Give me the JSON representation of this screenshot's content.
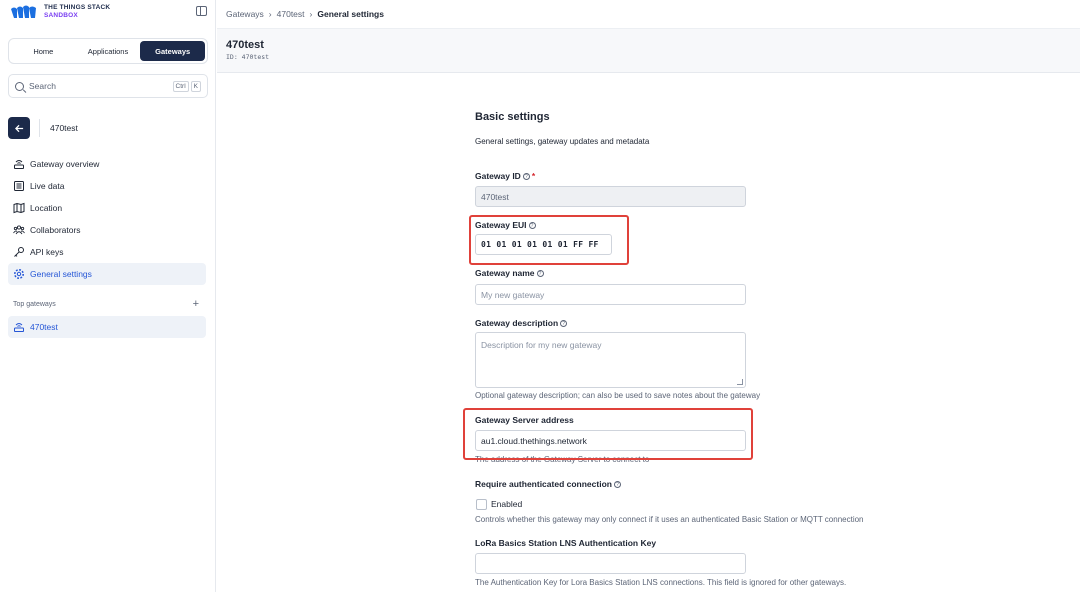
{
  "brand": {
    "line1": "THE THINGS STACK",
    "line2": "SANDBOX",
    "colors": {
      "navy": "#1c2a4a",
      "purple": "#7a3ff2",
      "accent": "#2556d6",
      "highlight": "#e0413a"
    }
  },
  "sidebar": {
    "tabs": [
      {
        "label": "Home"
      },
      {
        "label": "Applications"
      },
      {
        "label": "Gateways",
        "active": true
      }
    ],
    "search": {
      "placeholder": "Search",
      "shortcut": [
        "Ctrl",
        "K"
      ]
    },
    "context_title": "470test",
    "nav": [
      {
        "label": "Gateway overview",
        "icon": "gateway-icon"
      },
      {
        "label": "Live data",
        "icon": "list-icon"
      },
      {
        "label": "Location",
        "icon": "map-icon"
      },
      {
        "label": "Collaborators",
        "icon": "users-icon"
      },
      {
        "label": "API keys",
        "icon": "key-icon"
      },
      {
        "label": "General settings",
        "icon": "gear-icon",
        "active": true
      }
    ],
    "top_gateways": {
      "label": "Top gateways",
      "items": [
        {
          "label": "470test",
          "icon": "gateway-icon"
        }
      ]
    }
  },
  "breadcrumb": {
    "items": [
      "Gateways",
      "470test"
    ],
    "current": "General settings"
  },
  "header": {
    "title": "470test",
    "id_label": "ID:",
    "id_value": "470test"
  },
  "form": {
    "section_title": "Basic settings",
    "section_subtitle": "General settings, gateway updates and metadata",
    "gateway_id": {
      "label": "Gateway ID",
      "value": "470test"
    },
    "gateway_eui": {
      "label": "Gateway EUI",
      "value": "01 01 01 01 01 01 FF FF"
    },
    "gateway_name": {
      "label": "Gateway name",
      "placeholder": "My new gateway"
    },
    "gateway_description": {
      "label": "Gateway description",
      "placeholder": "Description for my new gateway",
      "help": "Optional gateway description; can also be used to save notes about the gateway"
    },
    "gateway_server_address": {
      "label": "Gateway Server address",
      "value": "au1.cloud.thethings.network",
      "help": "The address of the Gateway Server to connect to"
    },
    "require_auth": {
      "label": "Require authenticated connection",
      "checkbox_label": "Enabled",
      "help": "Controls whether this gateway may only connect if it uses an authenticated Basic Station or MQTT connection"
    },
    "lns_key": {
      "label": "LoRa Basics Station LNS Authentication Key",
      "help": "The Authentication Key for Lora Basics Station LNS connections. This field is ignored for other gateways."
    }
  }
}
